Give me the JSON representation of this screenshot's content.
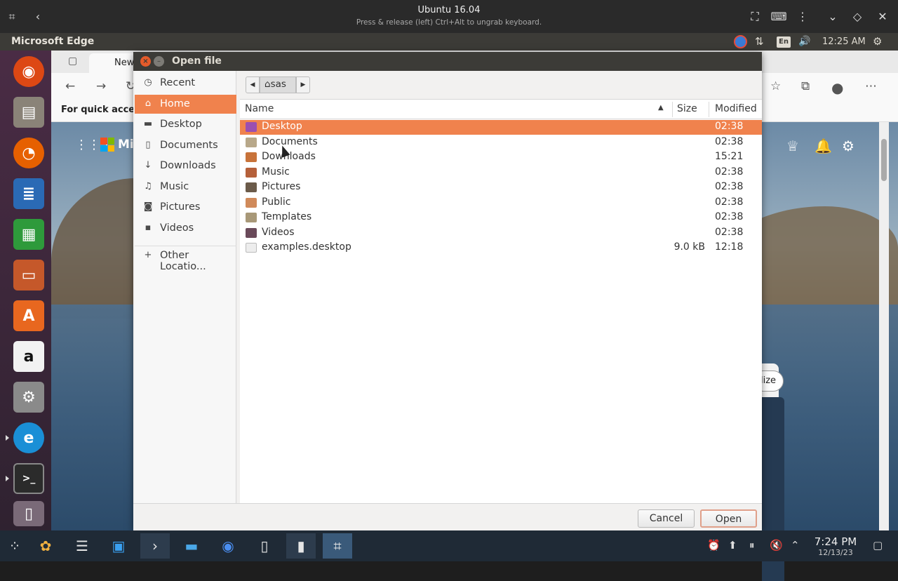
{
  "viewer": {
    "title": "Ubuntu 16.04",
    "subtitle": "Press & release (left) Ctrl+Alt to ungrab keyboard."
  },
  "ubuntu_panel": {
    "app_name": "Microsoft Edge",
    "lang": "En",
    "time": "12:25 AM"
  },
  "edge": {
    "tab_title": "New",
    "favbar_text": "For quick access",
    "ms_text": "Mic",
    "personalize_label": "lize"
  },
  "dialog": {
    "title": "Open file",
    "places": [
      {
        "label": "Recent",
        "icon": "clock-icon"
      },
      {
        "label": "Home",
        "icon": "home-icon",
        "active": true
      },
      {
        "label": "Desktop",
        "icon": "folder-icon"
      },
      {
        "label": "Documents",
        "icon": "document-icon"
      },
      {
        "label": "Downloads",
        "icon": "download-icon"
      },
      {
        "label": "Music",
        "icon": "music-icon"
      },
      {
        "label": "Pictures",
        "icon": "camera-icon"
      },
      {
        "label": "Videos",
        "icon": "video-icon"
      }
    ],
    "other_locations": "Other Locatio...",
    "path_segment": "sas",
    "columns": {
      "name": "Name",
      "size": "Size",
      "modified": "Modified"
    },
    "files": [
      {
        "name": "Desktop",
        "size": "",
        "modified": "02:38",
        "selected": true,
        "color": "#9b4fb0"
      },
      {
        "name": "Documents",
        "size": "",
        "modified": "02:38",
        "color": "#b8a88a"
      },
      {
        "name": "Downloads",
        "size": "",
        "modified": "15:21",
        "color": "#c8733a"
      },
      {
        "name": "Music",
        "size": "",
        "modified": "02:38",
        "color": "#b5603a"
      },
      {
        "name": "Pictures",
        "size": "",
        "modified": "02:38",
        "color": "#6b5b4a"
      },
      {
        "name": "Public",
        "size": "",
        "modified": "02:38",
        "color": "#d08a5a"
      },
      {
        "name": "Templates",
        "size": "",
        "modified": "02:38",
        "color": "#a89878"
      },
      {
        "name": "Videos",
        "size": "",
        "modified": "02:38",
        "color": "#6a4a5a"
      },
      {
        "name": "examples.desktop",
        "size": "9.0 kB",
        "modified": "12:18",
        "color": "#e8e8e8"
      }
    ],
    "cancel_label": "Cancel",
    "open_label": "Open"
  },
  "host_taskbar": {
    "time": "7:24 PM",
    "date": "12/13/23"
  },
  "colors": {
    "accent": "#f0824d",
    "panel": "#3c3b37",
    "taskbar": "#1f2a36"
  }
}
